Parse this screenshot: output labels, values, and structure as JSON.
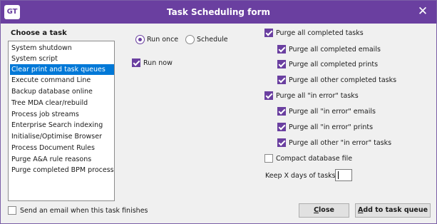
{
  "window": {
    "title": "Task Scheduling form",
    "logo_text": "GT",
    "close_glyph": "✕"
  },
  "tasks": {
    "heading": "Choose a task",
    "items": [
      "System shutdown",
      "System script",
      "Clear print and task queues",
      "Execute command Line",
      "Backup database online",
      "Tree MDA clear/rebuild",
      "Process job streams",
      "Enterprise Search indexing",
      "Initialise/Optimise Browser",
      "Process Document Rules",
      "Purge A&A rule reasons",
      "Purge completed BPM processes"
    ],
    "selected_index": 2
  },
  "schedule": {
    "run_once": "Run once",
    "schedule": "Schedule",
    "selected": "run_once",
    "run_now": "Run now",
    "run_now_checked": true
  },
  "options": {
    "purge_completed": "Purge all completed tasks",
    "purge_completed_emails": "Purge all completed emails",
    "purge_completed_prints": "Purge all completed prints",
    "purge_other_completed": "Purge all other completed tasks",
    "purge_error": "Purge all \"in error\" tasks",
    "purge_error_emails": "Purge all \"in error\" emails",
    "purge_error_prints": "Purge all \"in error\" prints",
    "purge_other_error": "Purge all other \"in error\" tasks",
    "compact_db": "Compact database file",
    "keep_days": "Keep X days of tasks",
    "keep_days_value": ""
  },
  "footer": {
    "email_label": "Send an email when this task finishes",
    "close_prefix": "",
    "close_hot": "C",
    "close_rest": "lose",
    "add_hot": "A",
    "add_rest": "dd to task queue"
  },
  "colors": {
    "accent": "#6a3fa0",
    "selection": "#0078d7"
  }
}
